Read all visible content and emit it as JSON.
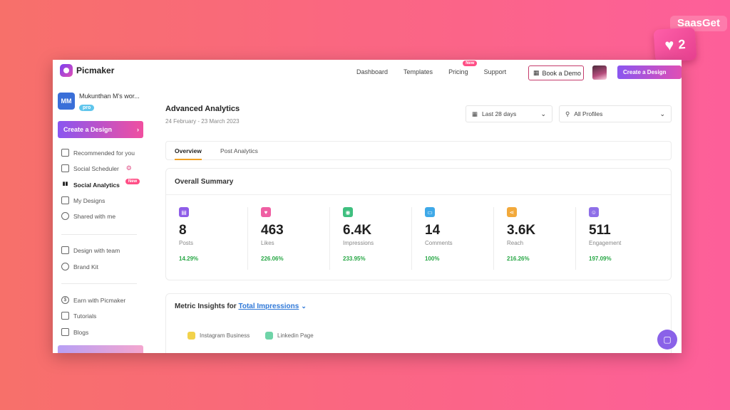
{
  "watermark": "SaasGet",
  "heart_badge": {
    "count": "2"
  },
  "brand": {
    "name": "Picmaker"
  },
  "topnav": {
    "links": [
      "Dashboard",
      "Templates",
      "Pricing",
      "Support"
    ],
    "pricing_badge": "New",
    "book_demo": "Book a Demo",
    "create_button": "Create a Design"
  },
  "sidebar": {
    "workspace": {
      "initials": "MM",
      "name": "Mukunthan M's wor...",
      "plan": "pro"
    },
    "create_button": "Create a Design",
    "items": [
      "Recommended for you",
      "Social Scheduler",
      "Social Analytics",
      "My Designs",
      "Shared with me",
      "Design with team",
      "Brand Kit",
      "Earn with Picmaker",
      "Tutorials",
      "Blogs"
    ],
    "analytics_badge": "New"
  },
  "main": {
    "title": "Advanced Analytics",
    "date_range": "24 February - 23 March 2023",
    "period_dropdown": "Last 28 days",
    "profiles_dropdown": "All Profiles",
    "tabs": [
      "Overview",
      "Post Analytics"
    ]
  },
  "summary": {
    "title": "Overall Summary",
    "stats": [
      {
        "value": "8",
        "label": "Posts",
        "delta": "14.29%",
        "color": "#8e5de8",
        "icon": "posts-icon"
      },
      {
        "value": "463",
        "label": "Likes",
        "delta": "226.06%",
        "color": "#ef5fa3",
        "icon": "heart-icon"
      },
      {
        "value": "6.4K",
        "label": "Impressions",
        "delta": "233.95%",
        "color": "#3fbf7f",
        "icon": "eye-icon"
      },
      {
        "value": "14",
        "label": "Comments",
        "delta": "100%",
        "color": "#3fa9e8",
        "icon": "comment-icon"
      },
      {
        "value": "3.6K",
        "label": "Reach",
        "delta": "216.26%",
        "color": "#f2a93b",
        "icon": "share-icon"
      },
      {
        "value": "511",
        "label": "Engagement",
        "delta": "197.09%",
        "color": "#8e6fe8",
        "icon": "user-icon"
      }
    ]
  },
  "insights": {
    "prefix": "Metric Insights for",
    "metric": "Total Impressions",
    "legend": [
      {
        "label": "Instagram Business",
        "color": "#f2d24b"
      },
      {
        "label": "Linkedin Page",
        "color": "#6fd4a8"
      }
    ]
  }
}
